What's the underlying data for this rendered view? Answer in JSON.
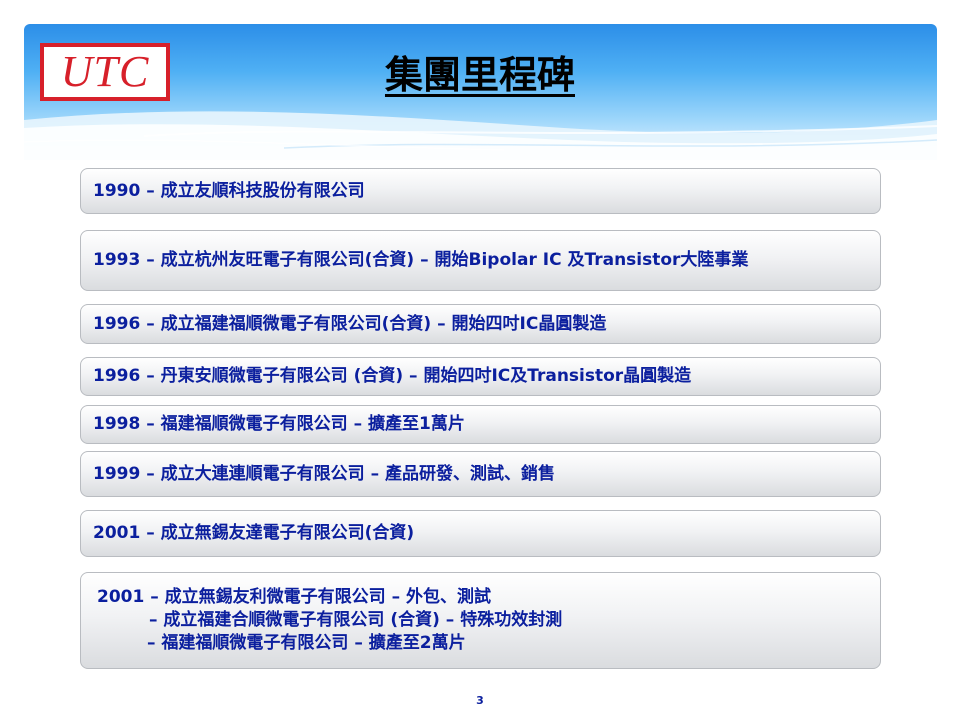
{
  "header": {
    "logo_text": "UTC",
    "title": "集團里程碑"
  },
  "milestones": [
    {
      "lines": [
        "1990 – 成立友順科技股份有限公司"
      ]
    },
    {
      "lines": [
        "1993 – 成立杭州友旺電子有限公司(合資)  – 開始Bipolar IC 及Transistor大陸事業"
      ]
    },
    {
      "lines": [
        "1996 – 成立福建福順微電子有限公司(合資)  – 開始四吋IC晶圓製造"
      ]
    },
    {
      "lines": [
        "1996 – 丹東安順微電子有限公司 (合資) – 開始四吋IC及Transistor晶圓製造"
      ]
    },
    {
      "lines": [
        "1998 – 福建福順微電子有限公司  – 擴產至1萬片"
      ]
    },
    {
      "lines": [
        "1999 – 成立大連連順電子有限公司  – 產品研發、測試、銷售"
      ]
    },
    {
      "lines": [
        "2001 – 成立無錫友達電子有限公司(合資)"
      ]
    },
    {
      "lines": [
        "2001 – 成立無錫友利微電子有限公司  – 外包、測試",
        "– 成立福建合順微電子有限公司  (合資)  – 特殊功效封測",
        "– 福建福順微電子有限公司  – 擴產至2萬片"
      ]
    }
  ],
  "footer": {
    "page_number": "3"
  }
}
